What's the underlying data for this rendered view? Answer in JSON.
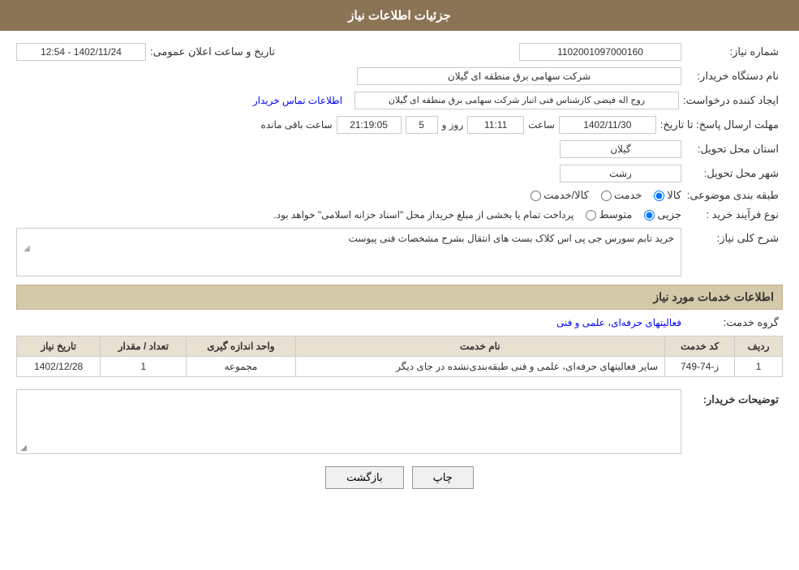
{
  "header": {
    "title": "جزئیات اطلاعات نیاز"
  },
  "form": {
    "need_number_label": "شماره نیاز:",
    "need_number_value": "1102001097000160",
    "buyer_name_label": "نام دستگاه خریدار:",
    "buyer_name_value": "شرکت سهامی برق منطقه ای گیلان",
    "creator_label": "ایجاد کننده درخواست:",
    "creator_value": "روح اله فیضی کارشناس فنی انبار شرکت سهامی برق منطقه ای گیلان",
    "creator_link": "اطلاعات تماس خریدار",
    "deadline_label": "مهلت ارسال پاسخ: تا تاریخ:",
    "deadline_date": "1402/11/30",
    "deadline_time_label": "ساعت",
    "deadline_time": "11:11",
    "deadline_days_label": "روز و",
    "deadline_days": "5",
    "deadline_remaining_label": "ساعت باقی مانده",
    "deadline_time2": "21:19:05",
    "province_label": "استان محل تحویل:",
    "province_value": "گیلان",
    "city_label": "شهر محل تحویل:",
    "city_value": "رشت",
    "category_label": "طبقه بندی موضوعی:",
    "category_kala": "کالا",
    "category_khadamat": "خدمت",
    "category_kala_khadamat": "کالا/خدمت",
    "purchase_type_label": "نوع فرآیند خرید :",
    "purchase_type_jozi": "جزیی",
    "purchase_type_motovaset": "متوسط",
    "purchase_type_desc": "پرداخت تمام یا بخشی از مبلغ خریداز محل \"اسناد خزانه اسلامی\" خواهد بود.",
    "description_label": "شرح کلی نیاز:",
    "description_value": "خرید تابم سورس جی پی اس کلاک بست های انتقال بشرح مشخصات فنی پیوست",
    "services_section_title": "اطلاعات خدمات مورد نیاز",
    "service_group_label": "گروه خدمت:",
    "service_group_value": "فعالیتهای حرفه‌ای، علمی و فنی",
    "table": {
      "headers": [
        "ردیف",
        "کد خدمت",
        "نام خدمت",
        "واحد اندازه گیری",
        "تعداد / مقدار",
        "تاریخ نیاز"
      ],
      "rows": [
        {
          "row_num": "1",
          "service_code": "ز-74-749",
          "service_name": "سایر فعالیتهای حرفه‌ای، علمی و فنی طبقه‌بندی‌نشده در جای دیگر",
          "unit": "مجموعه",
          "quantity": "1",
          "need_date": "1402/12/28"
        }
      ]
    },
    "buyer_desc_label": "توضیحات خریدار:",
    "buyer_desc_value": "",
    "announce_label": "تاریخ و ساعت اعلان عمومی:",
    "announce_value": "1402/11/24 - 12:54"
  },
  "buttons": {
    "print_label": "چاپ",
    "back_label": "بازگشت"
  }
}
